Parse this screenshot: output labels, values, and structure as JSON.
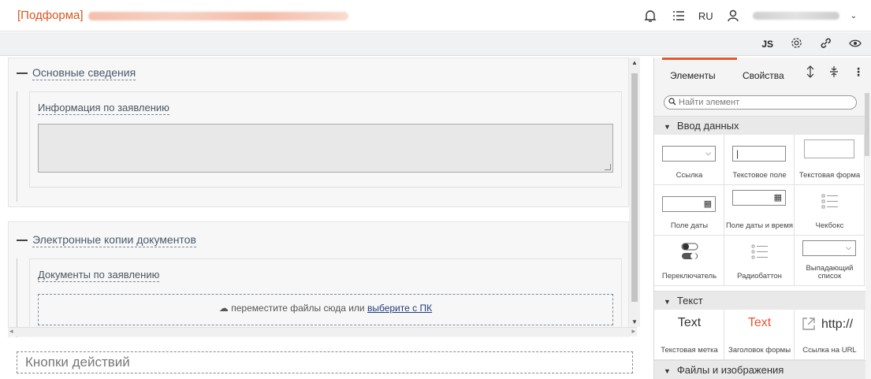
{
  "header": {
    "title": "[Подформа]",
    "lang": "RU",
    "icons": [
      "bell-icon",
      "list-icon",
      "user-icon",
      "chevron-down-icon"
    ]
  },
  "toolbar": {
    "js_label": "JS",
    "icons": [
      "settings-icon",
      "link-icon",
      "eye-icon"
    ]
  },
  "canvas": {
    "section1": {
      "title": "Основные сведения",
      "field_label": "Информация по заявлению"
    },
    "section2": {
      "title": "Электронные копии документов",
      "field_label": "Документы по заявлению",
      "dropzone_text": "переместите файлы сюда или ",
      "dropzone_link": "выберите с ПК"
    },
    "actions_placeholder": "Кнопки действий"
  },
  "panel": {
    "tabs": [
      "Элементы",
      "Свойства"
    ],
    "search_placeholder": "Найти элемент",
    "groups": [
      {
        "title": "Ввод данных",
        "items": [
          "Ссылка",
          "Текстовое поле",
          "Текстовая форма",
          "Поле даты",
          "Поле даты и время",
          "Чекбокс",
          "Переключатель",
          "Радиобаттон",
          "Выпадающий список"
        ]
      },
      {
        "title": "Текст",
        "items": [
          "Текстовая метка",
          "Заголовок формы",
          "Ссылка на URL"
        ],
        "previews": [
          "Text",
          "Text",
          "http://"
        ]
      },
      {
        "title": "Файлы и изображения"
      }
    ]
  },
  "colors": {
    "accent": "#e4572e",
    "title": "#d9541e",
    "link": "#1f3d7a"
  }
}
